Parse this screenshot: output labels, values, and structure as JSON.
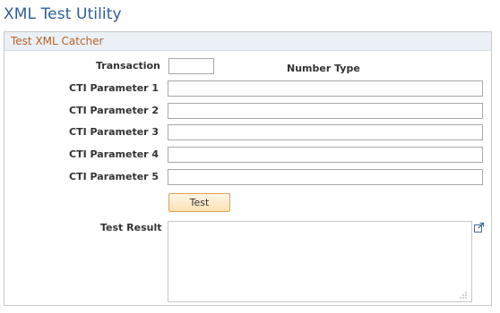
{
  "page": {
    "title": "XML Test Utility"
  },
  "group": {
    "header": "Test XML Catcher"
  },
  "form": {
    "transaction_label": "Transaction",
    "transaction_value": "",
    "number_type_label": "Number Type",
    "params": [
      {
        "label": "CTI Parameter 1",
        "value": ""
      },
      {
        "label": "CTI Parameter 2",
        "value": ""
      },
      {
        "label": "CTI Parameter 3",
        "value": ""
      },
      {
        "label": "CTI Parameter 4",
        "value": ""
      },
      {
        "label": "CTI Parameter 5",
        "value": ""
      }
    ],
    "test_button_label": "Test",
    "result_label": "Test Result",
    "result_value": ""
  },
  "icons": {
    "expand": "expand-icon",
    "resize_grip": "resize-grip-icon"
  },
  "colors": {
    "title": "#2e5e96",
    "group_header_text": "#b8622b",
    "group_header_bg": "#eaf0f5",
    "button_border": "#d9a45a",
    "button_bg": "#fbe1b2"
  }
}
